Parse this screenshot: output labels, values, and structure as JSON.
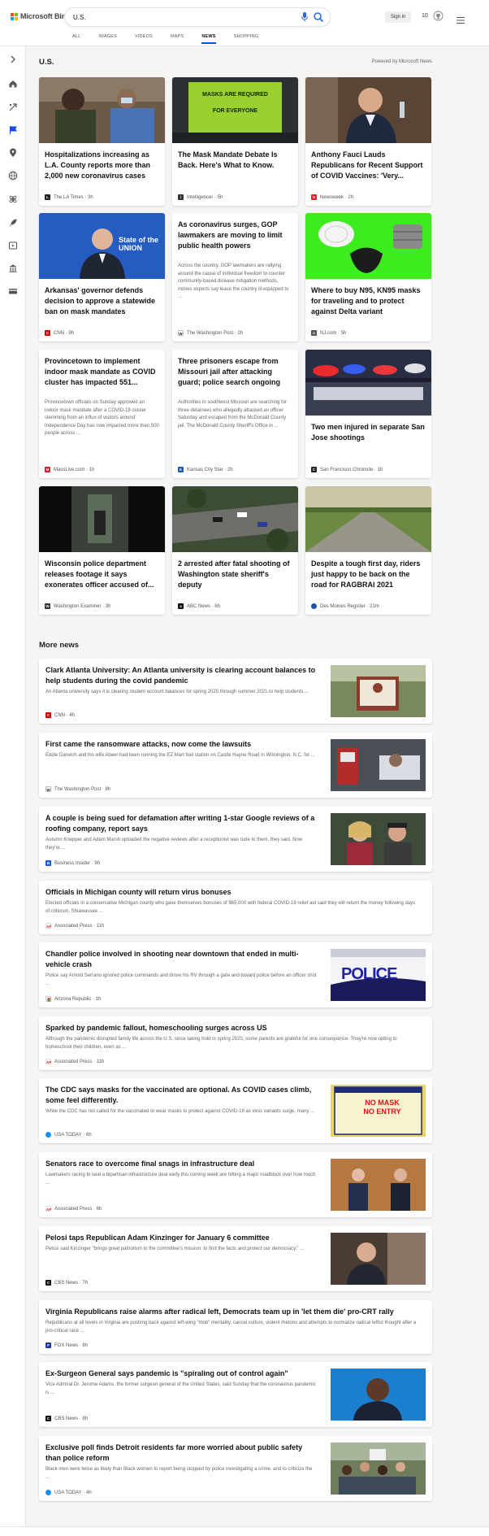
{
  "header": {
    "brand": "Microsoft Bing",
    "search_value": "U.S.",
    "signin_label": "Sign in",
    "points": "10",
    "tabs": [
      "ALL",
      "IMAGES",
      "VIDEOS",
      "MAPS",
      "NEWS",
      "SHOPPING"
    ],
    "active_tab": "NEWS"
  },
  "section": {
    "title": "U.S.",
    "powered_by": "Powered by Microsoft News"
  },
  "cards": [
    {
      "title": "Hospitalizations increasing as L.A. County reports more than 2,000 new coronavirus cases",
      "snippet": "",
      "source": "The LA Times",
      "time": "3h"
    },
    {
      "title": "The Mask Mandate Debate Is Back. Here's What to Know.",
      "snippet": "",
      "source": "Intelligencer",
      "time": "5h"
    },
    {
      "title": "Anthony Fauci Lauds Republicans for Recent Support of COVID Vaccines: 'Very...",
      "snippet": "",
      "source": "Newsweek",
      "time": "2h"
    },
    {
      "title": "Arkansas' governor defends decision to approve a statewide ban on mask mandates",
      "snippet": "",
      "source": "CNN",
      "time": "9h"
    },
    {
      "title": "As coronavirus surges, GOP lawmakers are moving to limit public health powers",
      "snippet": "Across the country, GOP lawmakers are rallying around the cause of individual freedom to counter community-based disease mitigation methods, moves experts say leave the country ill-equipped to ...",
      "source": "The Washington Post",
      "time": "2h"
    },
    {
      "title": "Where to buy N95, KN95 masks for traveling and to protect against Delta variant",
      "snippet": "",
      "source": "NJ.com",
      "time": "5h"
    },
    {
      "title": "Provincetown to implement indoor mask mandate as COVID cluster has impacted 551...",
      "snippet": "Provincetown officials on Sunday approved an indoor mask mandate after a COVID-19 cluster stemming from an influx of visitors around Independence Day has now impacted more than 500 people across ...",
      "source": "MassLive.com",
      "time": "1h"
    },
    {
      "title": "Three prisoners escape from Missouri jail after attacking guard; police search ongoing",
      "snippet": "Authorities in southwest Missouri are searching for three detainees who allegedly attacked an officer Saturday and escaped from the McDonald County jail. The McDonald County Sheriff's Office in ...",
      "source": "Kansas City Star",
      "time": "2h"
    },
    {
      "title": "Two men injured in separate San Jose shootings",
      "snippet": "",
      "source": "San Francisco Chronicle",
      "time": "1h"
    },
    {
      "title": "Wisconsin police department releases footage it says exonerates officer accused of...",
      "snippet": "",
      "source": "Washington Examiner",
      "time": "3h"
    },
    {
      "title": "2 arrested after fatal shooting of Washington state sheriff's deputy",
      "snippet": "",
      "source": "ABC News",
      "time": "6h"
    },
    {
      "title": "Despite a tough first day, riders just happy to be back on the road for RAGBRAI 2021",
      "snippet": "",
      "source": "Des Moines Register",
      "time": "21m"
    }
  ],
  "more_news": {
    "title": "More news",
    "items": [
      {
        "title": "Clark Atlanta University: An Atlanta university is clearing account balances to help students during the covid pandemic",
        "snippet": "An Atlanta university says it is clearing student account balances for spring 2020 through summer 2021 to help students ...",
        "source": "CNN",
        "time": "4h"
      },
      {
        "title": "First came the ransomware attacks, now come the lawsuits",
        "snippet": "Eddie Darwich and his wife Abeer had been running the EZ Mart fuel station on Castle Hayne Road in Wilmington, N.C. for ...",
        "source": "The Washington Post",
        "time": "8h"
      },
      {
        "title": "A couple is being sued for defamation after writing 1-star Google reviews of a roofing company, report says",
        "snippet": "Autumn Knepper and Adam Marsh uploaded the negative reviews after a receptionist was rude to them, they said. Now they're ...",
        "source": "Business Insider",
        "time": "9h"
      },
      {
        "title": "Officials in Michigan county will return virus bonuses",
        "snippet": "Elected officials in a conservative Michigan county who gave themselves bonuses of $65,000 with federal COVID-19 relief aid said they will return the money following days of criticism. Shiawassee ...",
        "source": "Associated Press",
        "time": "11h"
      },
      {
        "title": "Chandler police involved in shooting near downtown that ended in multi-vehicle crash",
        "snippet": "Police say Arnold Serrano ignored police commands and drove his RV through a gate and toward police before an officer shot ...",
        "source": "Arizona Republic",
        "time": "1h"
      },
      {
        "title": "Sparked by pandemic fallout, homeschooling surges across US",
        "snippet": "Although the pandemic disrupted family life across the U.S. since taking hold in spring 2020, some parents are grateful for one consequence: They're now opting to homeschool their children, even as ...",
        "source": "Associated Press",
        "time": "11h"
      },
      {
        "title": "The CDC says masks for the vaccinated are optional. As COVID cases climb, some feel differently.",
        "snippet": "While the CDC has not called for the vaccinated to wear masks to protect against COVID-19 as virus variants surge, many ...",
        "source": "USA TODAY",
        "time": "6h"
      },
      {
        "title": "Senators race to overcome final snags in infrastructure deal",
        "snippet": "Lawmakers racing to seal a bipartisan infrastructure deal early this coming week are hitting a major roadblock over how much ...",
        "source": "Associated Press",
        "time": "6h"
      },
      {
        "title": "Pelosi taps Republican Adam Kinzinger for January 6 committee",
        "snippet": "Pelosi said Kinzinger \"brings great patriotism to the committee's mission: to find the facts and protect our democracy.\" ...",
        "source": "CBS News",
        "time": "7h"
      },
      {
        "title": "Virginia Republicans raise alarms after radical left, Democrats team up in 'let them die' pro-CRT rally",
        "snippet": "Republicans at all levels in Virginia are pushing back against left-wing \"mob\" mentality, cancel culture, violent rhetoric and attempts to normalize radical leftist thought after a pro-critical race ...",
        "source": "FOX News",
        "time": "8h"
      },
      {
        "title": "Ex-Surgeon General says pandemic is \"spiraling out of control again\"",
        "snippet": "Vice Admiral Dr. Jerome Adams, the former surgeon general of the United States, said Sunday that the coronavirus pandemic is ...",
        "source": "CBS News",
        "time": "8h"
      },
      {
        "title": "Exclusive poll finds Detroit residents far more worried about public safety than police reform",
        "snippet": "Black men were twice as likely than Black women to report being stopped by police investigating a crime, and to criticize the ...",
        "source": "USA TODAY",
        "time": "4h"
      }
    ]
  },
  "image_text": {
    "mask_sign_1": "MASKS ARE REQUIRED",
    "mask_sign_2": "FOR EVERYONE",
    "state_of_union": "State of the UNION",
    "police": "POLICE",
    "no_mask": "NO MASK",
    "no_entry": "NO ENTRY"
  },
  "colors": {
    "accent": "#174ae4",
    "ms_red": "#f25022",
    "ms_green": "#7fba00",
    "ms_blue": "#00a4ef",
    "ms_yellow": "#ffb900"
  }
}
